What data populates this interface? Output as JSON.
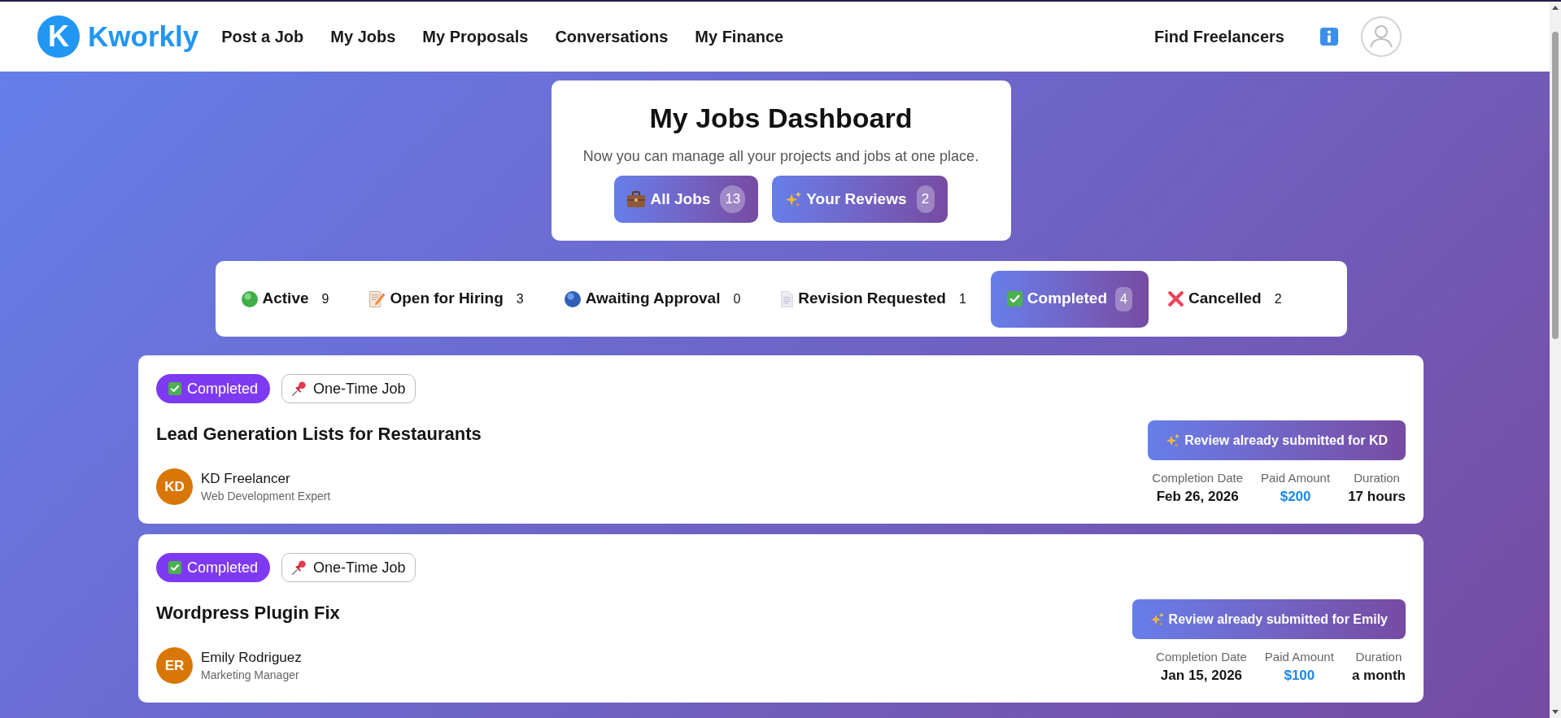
{
  "header": {
    "logo": {
      "mark": "K",
      "name": "Kworkly"
    },
    "nav": [
      "Post a Job",
      "My Jobs",
      "My Proposals",
      "Conversations",
      "My Finance"
    ],
    "find_link": "Find Freelancers"
  },
  "dashboard": {
    "title": "My Jobs Dashboard",
    "subtitle": "Now you can manage all your projects and jobs at one place.",
    "buttons": [
      {
        "kind": "jobs",
        "label": "All Jobs",
        "count": "13"
      },
      {
        "kind": "reviews",
        "label": "Your Reviews",
        "count": "2"
      }
    ]
  },
  "status_tabs": [
    {
      "kind": "active",
      "label": "Active",
      "count": "9",
      "selected": false
    },
    {
      "kind": "hiring",
      "label": "Open for Hiring",
      "count": "3",
      "selected": false
    },
    {
      "kind": "awaiting",
      "label": "Awaiting Approval",
      "count": "0",
      "selected": false
    },
    {
      "kind": "revision",
      "label": "Revision Requested",
      "count": "1",
      "selected": false
    },
    {
      "kind": "completed",
      "label": "Completed",
      "count": "4",
      "selected": true
    },
    {
      "kind": "cancelled",
      "label": "Cancelled",
      "count": "2",
      "selected": false
    }
  ],
  "jobs": [
    {
      "status": {
        "kind": "completed",
        "label": "Completed"
      },
      "job_type": "One-Time Job",
      "title": "Lead Generation Lists for Restaurants",
      "freelancer": {
        "initials": "KD",
        "name": "KD Freelancer",
        "role": "Web Development Expert"
      },
      "action": "Review already submitted for KD",
      "stats": [
        {
          "kind": "date",
          "label": "Completion Date",
          "value": "Feb 26, 2026"
        },
        {
          "kind": "amount",
          "label": "Paid Amount",
          "value": "$200"
        },
        {
          "kind": "duration",
          "label": "Duration",
          "value": "17 hours"
        }
      ]
    },
    {
      "status": {
        "kind": "completed",
        "label": "Completed"
      },
      "job_type": "One-Time Job",
      "title": "Wordpress Plugin Fix",
      "freelancer": {
        "initials": "ER",
        "name": "Emily Rodriguez",
        "role": "Marketing Manager"
      },
      "action": "Review already submitted for Emily",
      "stats": [
        {
          "kind": "date",
          "label": "Completion Date",
          "value": "Jan 15, 2026"
        },
        {
          "kind": "amount",
          "label": "Paid Amount",
          "value": "$100"
        },
        {
          "kind": "duration",
          "label": "Duration",
          "value": "a month"
        }
      ]
    }
  ]
}
